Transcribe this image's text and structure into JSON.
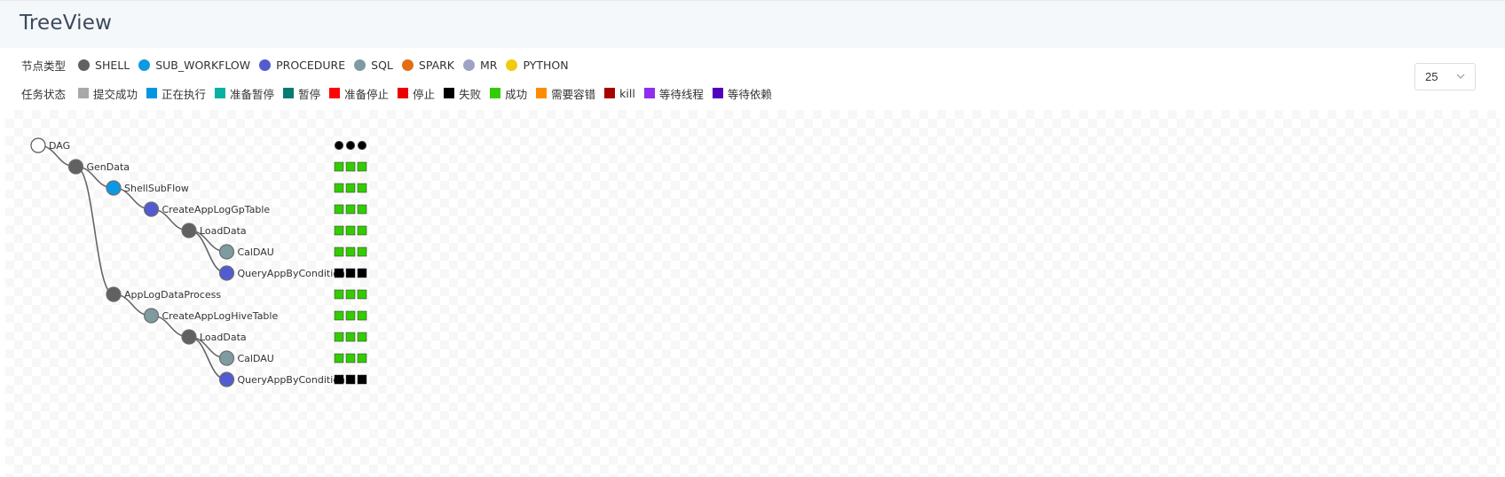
{
  "header": {
    "title": "TreeView"
  },
  "legend": {
    "node_types_label": "节点类型",
    "node_types": [
      {
        "name": "SHELL",
        "color": "#616161"
      },
      {
        "name": "SUB_WORKFLOW",
        "color": "#0d99e2"
      },
      {
        "name": "PROCEDURE",
        "color": "#525cd0"
      },
      {
        "name": "SQL",
        "color": "#7e9ba0"
      },
      {
        "name": "SPARK",
        "color": "#e46f13"
      },
      {
        "name": "MR",
        "color": "#9ea3c4"
      },
      {
        "name": "PYTHON",
        "color": "#f2ca0b"
      }
    ],
    "task_states_label": "任务状态",
    "task_states": [
      {
        "name": "提交成功",
        "color": "#a9a9a9"
      },
      {
        "name": "正在执行",
        "color": "#0097e0"
      },
      {
        "name": "准备暂停",
        "color": "#07b1a3"
      },
      {
        "name": "暂停",
        "color": "#057c72"
      },
      {
        "name": "准备停止",
        "color": "#fe0402"
      },
      {
        "name": "停止",
        "color": "#e90101"
      },
      {
        "name": "失败",
        "color": "#000000"
      },
      {
        "name": "成功",
        "color": "#33cc00"
      },
      {
        "name": "需要容错",
        "color": "#ff8c00"
      },
      {
        "name": "kill",
        "color": "#a70202"
      },
      {
        "name": "等待线程",
        "color": "#912eed"
      },
      {
        "name": "等待依赖",
        "color": "#5101be"
      }
    ]
  },
  "limit_select": {
    "value": "25"
  },
  "tree": {
    "nodes": [
      {
        "label": "DAG",
        "type": "root",
        "depth": 0,
        "parent": null,
        "states": [
          "root",
          "root",
          "root"
        ]
      },
      {
        "label": "GenData",
        "type": "SHELL",
        "depth": 1,
        "parent": 0,
        "states": [
          "成功",
          "成功",
          "成功"
        ]
      },
      {
        "label": "ShellSubFlow",
        "type": "SUB_WORKFLOW",
        "depth": 2,
        "parent": 1,
        "states": [
          "成功",
          "成功",
          "成功"
        ]
      },
      {
        "label": "CreateAppLogGpTable",
        "type": "PROCEDURE",
        "depth": 3,
        "parent": 2,
        "states": [
          "成功",
          "成功",
          "成功"
        ]
      },
      {
        "label": "LoadData",
        "type": "SHELL",
        "depth": 4,
        "parent": 3,
        "states": [
          "成功",
          "成功",
          "成功"
        ]
      },
      {
        "label": "CalDAU",
        "type": "SQL",
        "depth": 5,
        "parent": 4,
        "states": [
          "成功",
          "成功",
          "成功"
        ]
      },
      {
        "label": "QueryAppByCondition",
        "type": "PROCEDURE",
        "depth": 5,
        "parent": 4,
        "states": [
          "失败",
          "失败",
          "失败"
        ]
      },
      {
        "label": "AppLogDataProcess",
        "type": "SHELL",
        "depth": 2,
        "parent": 1,
        "states": [
          "成功",
          "成功",
          "成功"
        ]
      },
      {
        "label": "CreateAppLogHiveTable",
        "type": "SQL",
        "depth": 3,
        "parent": 7,
        "states": [
          "成功",
          "成功",
          "成功"
        ]
      },
      {
        "label": "LoadData",
        "type": "SHELL",
        "depth": 4,
        "parent": 8,
        "states": [
          "成功",
          "成功",
          "成功"
        ]
      },
      {
        "label": "CalDAU",
        "type": "SQL",
        "depth": 5,
        "parent": 9,
        "states": [
          "成功",
          "成功",
          "成功"
        ]
      },
      {
        "label": "QueryAppByCondition",
        "type": "PROCEDURE",
        "depth": 5,
        "parent": 9,
        "states": [
          "失败",
          "失败",
          "失败"
        ]
      }
    ]
  }
}
